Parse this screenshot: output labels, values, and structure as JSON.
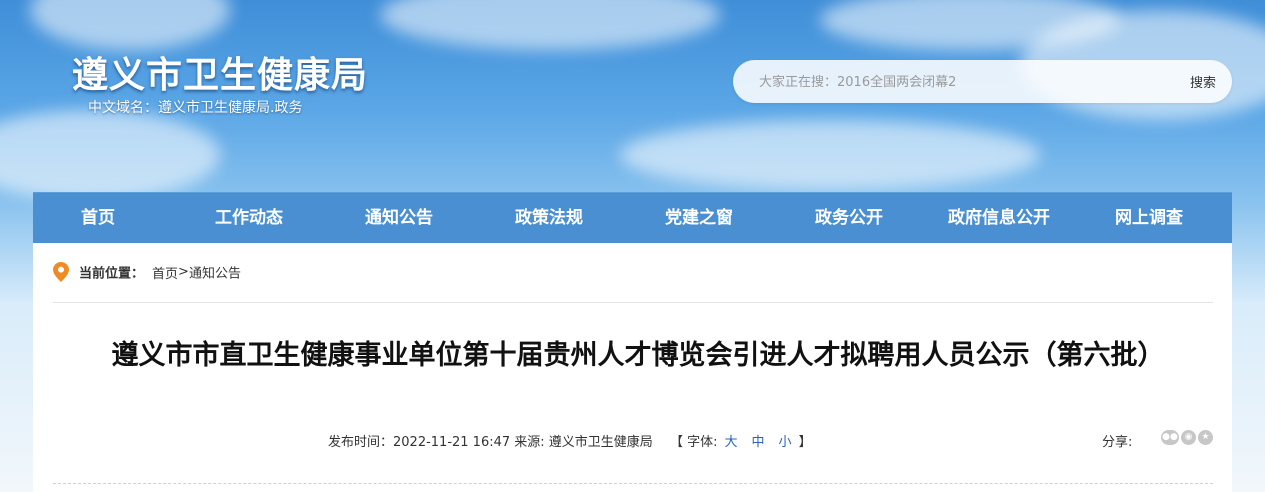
{
  "site": {
    "title": "遵义市卫生健康局",
    "domain": "中文域名：遵义市卫生健康局.政务"
  },
  "search": {
    "placeholder": "大家正在搜：2016全国两会闭幕2",
    "button_label": "搜索"
  },
  "nav": {
    "items": [
      {
        "label": "首页"
      },
      {
        "label": "工作动态"
      },
      {
        "label": "通知公告"
      },
      {
        "label": "政策法规"
      },
      {
        "label": "党建之窗"
      },
      {
        "label": "政务公开"
      },
      {
        "label": "政府信息公开"
      },
      {
        "label": "网上调查"
      }
    ]
  },
  "breadcrumb": {
    "label": "当前位置：",
    "home": "首页",
    "separator": ">",
    "current": "通知公告"
  },
  "article": {
    "title": "遵义市市直卫生健康事业单位第十届贵州人才博览会引进人才拟聘用人员公示（第六批）",
    "meta": "发布时间：2022-11-21 16:47 来源: 遵义市卫生健康局",
    "font_size": {
      "open": "【 字体:",
      "large": "大",
      "medium": "中",
      "small": "小",
      "close": "】"
    },
    "share_label": "分享:"
  },
  "icons": {
    "location": "location-pin-icon",
    "share": [
      "wechat-icon",
      "weibo-icon",
      "qzone-icon"
    ]
  },
  "colors": {
    "nav_bg": "#4a8fd1",
    "link_blue": "#2a63b8",
    "location_orange": "#f08a24"
  }
}
